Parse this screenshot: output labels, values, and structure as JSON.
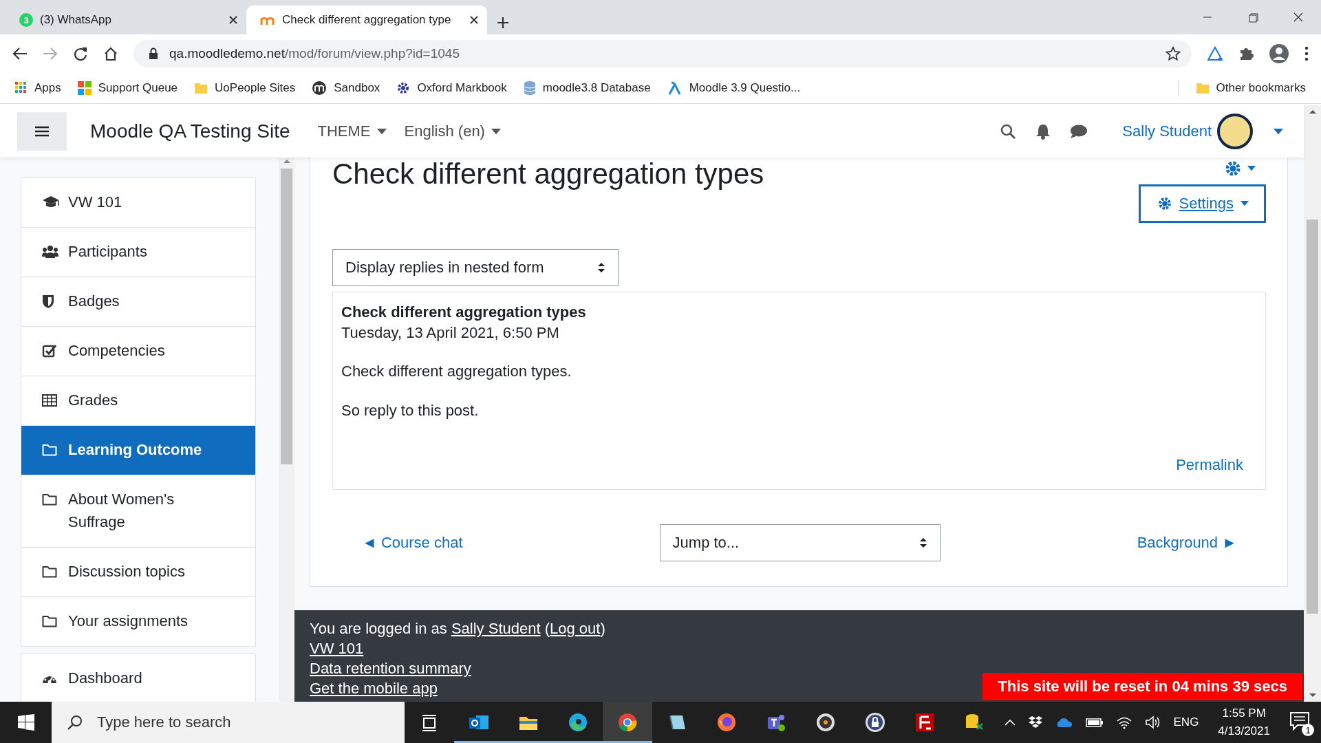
{
  "browser": {
    "tabs": [
      {
        "title": "(3) WhatsApp",
        "badge": "3",
        "kind": "whatsapp",
        "selected": false
      },
      {
        "title": "Check different aggregation type",
        "kind": "moodle",
        "selected": true
      }
    ],
    "url": {
      "host": "qa.moodledemo.net",
      "path": "/mod/forum/view.php?id=1045"
    },
    "bookmarks": [
      {
        "label": "Apps",
        "kind": "apps"
      },
      {
        "label": "Support Queue",
        "kind": "windows"
      },
      {
        "label": "UoPeople Sites",
        "kind": "folder"
      },
      {
        "label": "Sandbox",
        "kind": "m-circle"
      },
      {
        "label": "Oxford Markbook",
        "kind": "gear"
      },
      {
        "label": "moodle3.8 Database",
        "kind": "database"
      },
      {
        "label": "Moodle 3.9 Questio...",
        "kind": "lambda"
      }
    ],
    "other_bookmarks": "Other bookmarks"
  },
  "header": {
    "site_name": "Moodle QA Testing Site",
    "menus": [
      "THEME",
      "English (en)"
    ],
    "user": "Sally Student"
  },
  "nav_drawer": {
    "sections": [
      {
        "items": [
          {
            "label": "VW 101",
            "kind": "cap",
            "selected": false
          },
          {
            "label": "Participants",
            "kind": "users",
            "selected": false
          },
          {
            "label": "Badges",
            "kind": "shield",
            "selected": false
          },
          {
            "label": "Competencies",
            "kind": "check",
            "selected": false
          },
          {
            "label": "Grades",
            "kind": "table",
            "selected": false
          },
          {
            "label": "Learning Outcome",
            "kind": "folder",
            "selected": true
          },
          {
            "label": "About Women's Suffrage",
            "kind": "folder",
            "selected": false
          },
          {
            "label": "Discussion topics",
            "kind": "folder",
            "selected": false
          },
          {
            "label": "Your assignments",
            "kind": "folder",
            "selected": false
          }
        ]
      },
      {
        "items": [
          {
            "label": "Dashboard",
            "kind": "gauge",
            "selected": false
          }
        ]
      }
    ]
  },
  "main": {
    "title": "Check different aggregation types",
    "settings": "Settings",
    "display_mode": "Display replies in nested form",
    "post": {
      "subject": "Check different aggregation types",
      "date": "Tuesday, 13 April 2021, 6:50 PM",
      "paragraphs": [
        "Check different aggregation types.",
        "So reply to this post."
      ],
      "permalink": "Permalink"
    },
    "prev_link": "◄ Course chat",
    "jump_to": "Jump to...",
    "next_link": "Background ►"
  },
  "footer": {
    "logged_in": [
      {
        "kind": "text",
        "text": "You are logged in as "
      },
      {
        "kind": "link",
        "text": "Sally Student"
      },
      {
        "kind": "text",
        "text": " ("
      },
      {
        "kind": "link",
        "text": "Log out"
      },
      {
        "kind": "text",
        "text": ")"
      }
    ],
    "links": [
      "VW 101",
      "Data retention summary",
      "Get the mobile app"
    ]
  },
  "reset_banner": "This site will be reset in 04 mins 39 secs",
  "taskbar": {
    "search_placeholder": "Type here to search",
    "apps": [
      {
        "kind": "taskview",
        "running": false,
        "selected": false
      },
      {
        "kind": "outlook",
        "running": true,
        "selected": false
      },
      {
        "kind": "explorer",
        "running": true,
        "selected": false
      },
      {
        "kind": "edge",
        "running": true,
        "selected": false
      },
      {
        "kind": "chrome",
        "running": true,
        "selected": true
      },
      {
        "kind": "notebook",
        "running": false,
        "selected": false
      },
      {
        "kind": "firefox",
        "running": false,
        "selected": false
      },
      {
        "kind": "teams",
        "running": false,
        "selected": false
      },
      {
        "kind": "disc",
        "running": false,
        "selected": false
      },
      {
        "kind": "lock",
        "running": false,
        "selected": false
      },
      {
        "kind": "filezilla",
        "running": false,
        "selected": false
      },
      {
        "kind": "dbtool",
        "running": false,
        "selected": false
      }
    ],
    "language": "ENG",
    "time": "1:55 PM",
    "date": "4/13/2021",
    "notifications": "1"
  }
}
